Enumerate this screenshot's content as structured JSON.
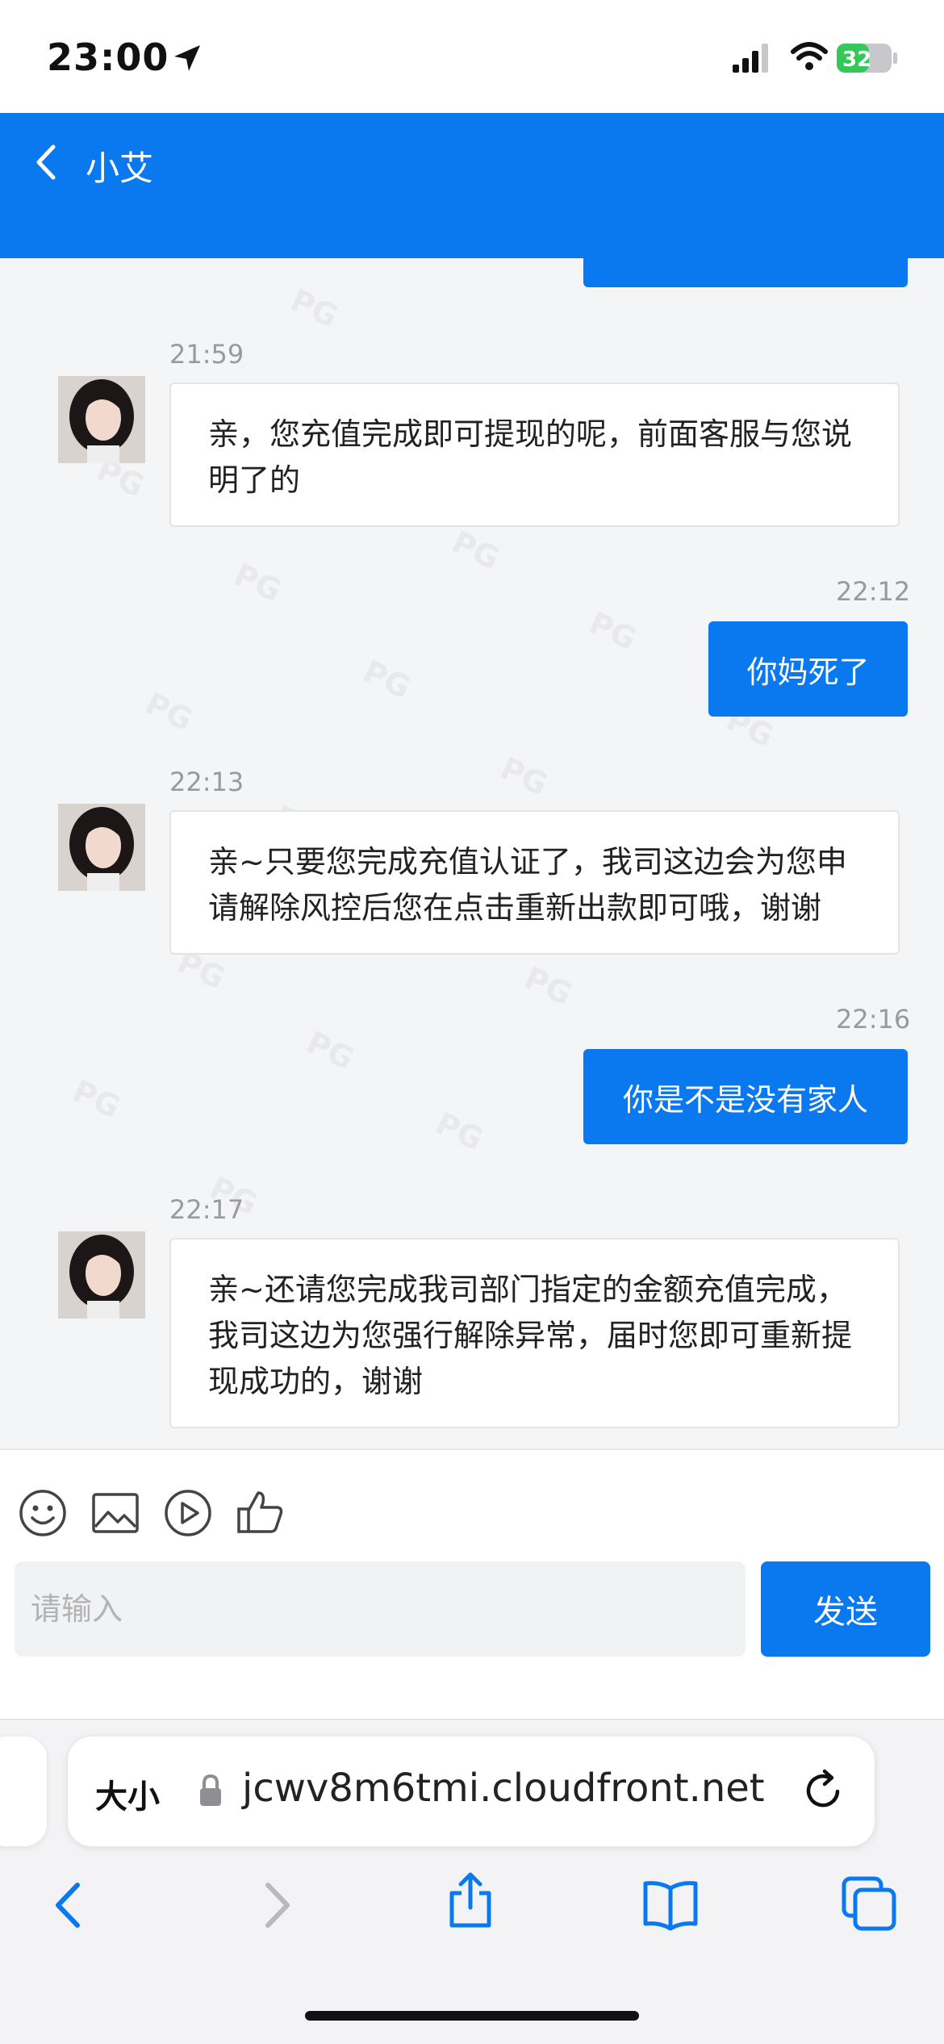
{
  "status_bar": {
    "time": "23:00",
    "battery": "32"
  },
  "header": {
    "title": "小艾"
  },
  "messages": [
    {
      "time": "21:59",
      "text": "亲，您充值完成即可提现的呢，前面客服与您说明了的"
    },
    {
      "time": "22:12",
      "text": "你妈死了"
    },
    {
      "time": "22:13",
      "text": "亲~只要您完成充值认证了，我司这边会为您申请解除风控后您在点击重新出款即可哦，谢谢"
    },
    {
      "time": "22:16",
      "text": "你是不是没有家人"
    },
    {
      "time": "22:17",
      "text": "亲~还请您完成我司部门指定的金额充值完成，我司这边为您强行解除异常，届时您即可重新提现成功的，谢谢"
    }
  ],
  "input": {
    "placeholder": "请输入",
    "send_label": "发送"
  },
  "browser": {
    "aa_label": "大小",
    "url": "jcwv8m6tmi.cloudfront.net"
  },
  "colors": {
    "accent": "#0a79f0",
    "background": "#f4f5f7"
  },
  "watermark": "PG"
}
